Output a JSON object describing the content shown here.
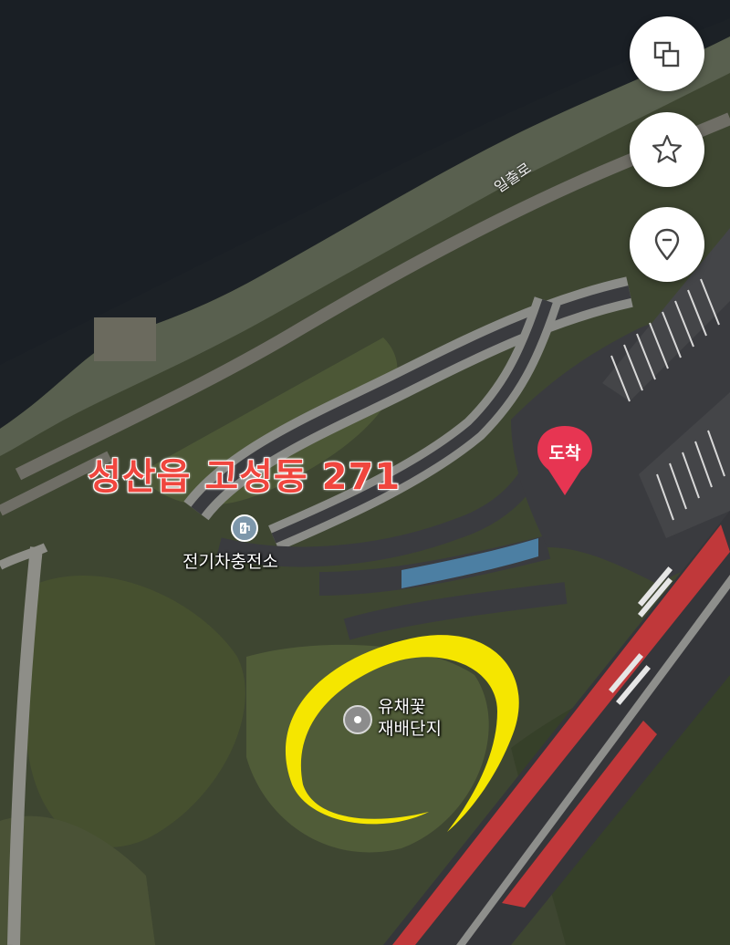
{
  "map": {
    "colors": {
      "water": "#1c2126",
      "land": "#3e4631",
      "road": "#3a3b3f",
      "parking": "#8e8f8c",
      "highlight": "#f5e600",
      "address": "#f0463e",
      "pin": "#e73552"
    },
    "address_label": "성산읍 고성동 271",
    "road_label": "일출로",
    "destination": {
      "label": "도착",
      "icon": "pin-icon"
    },
    "pois": [
      {
        "name": "전기차충전소",
        "icon": "ev-charger-icon"
      },
      {
        "name_line1": "유채꽃",
        "name_line2": "재배단지",
        "icon": "place-dot-icon"
      }
    ]
  },
  "controls": [
    {
      "name": "layers-button",
      "icon": "layers-icon"
    },
    {
      "name": "favorite-button",
      "icon": "star-icon"
    },
    {
      "name": "location-button",
      "icon": "location-pin-icon"
    }
  ]
}
